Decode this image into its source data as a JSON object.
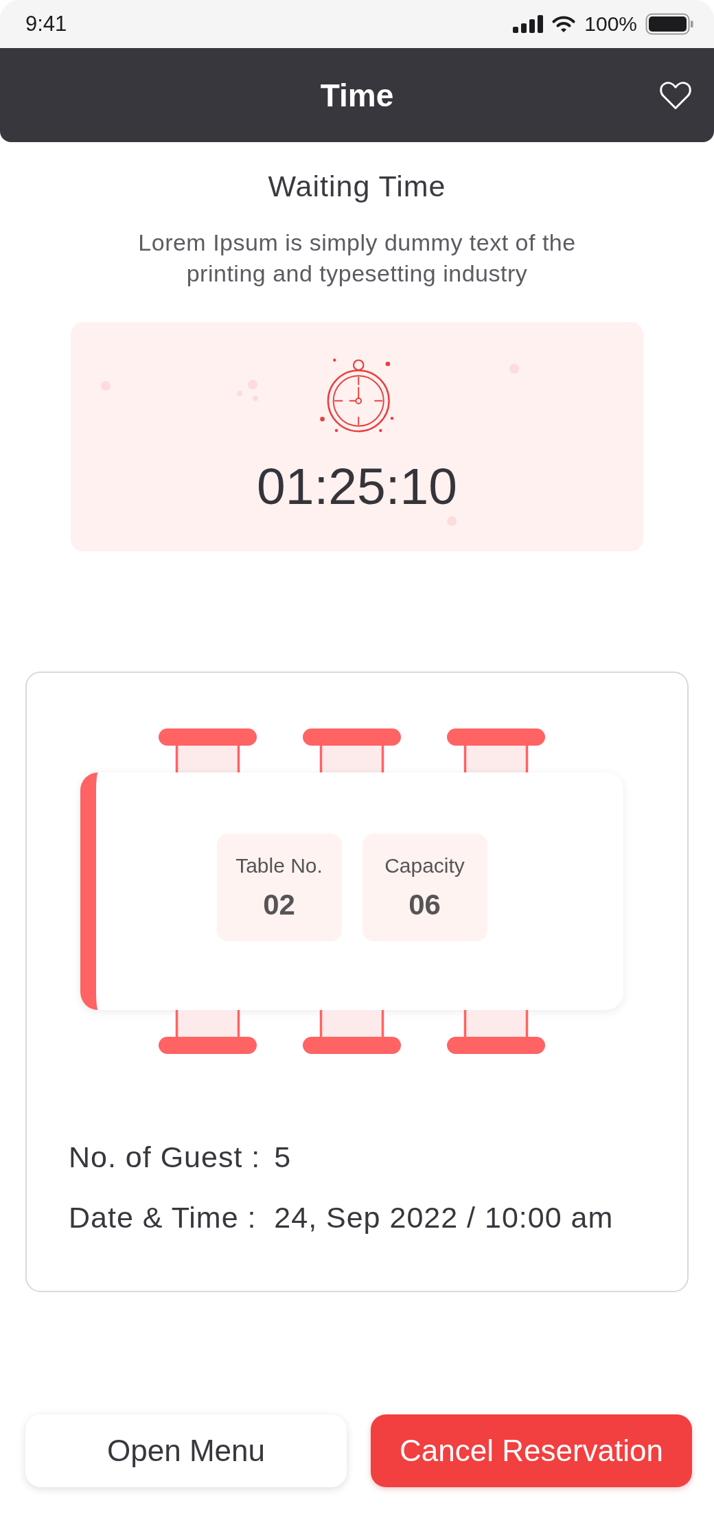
{
  "status_bar": {
    "time": "9:41",
    "battery": "100%"
  },
  "header": {
    "title": "Time"
  },
  "waiting": {
    "title": "Waiting Time",
    "description": "Lorem Ipsum is simply dummy text of the printing and typesetting industry",
    "timer": "01:25:10"
  },
  "reservation": {
    "table_info": [
      {
        "label": "Table No.",
        "value": "02"
      },
      {
        "label": "Capacity",
        "value": "06"
      }
    ],
    "details": [
      {
        "label": "No. of Guest :",
        "value": "5"
      },
      {
        "label": "Date & Time :",
        "value": "24, Sep 2022 / 10:00 am"
      }
    ]
  },
  "buttons": [
    {
      "label": "Open Menu",
      "kind": "secondary"
    },
    {
      "label": "Cancel Reservation",
      "kind": "primary"
    }
  ]
}
